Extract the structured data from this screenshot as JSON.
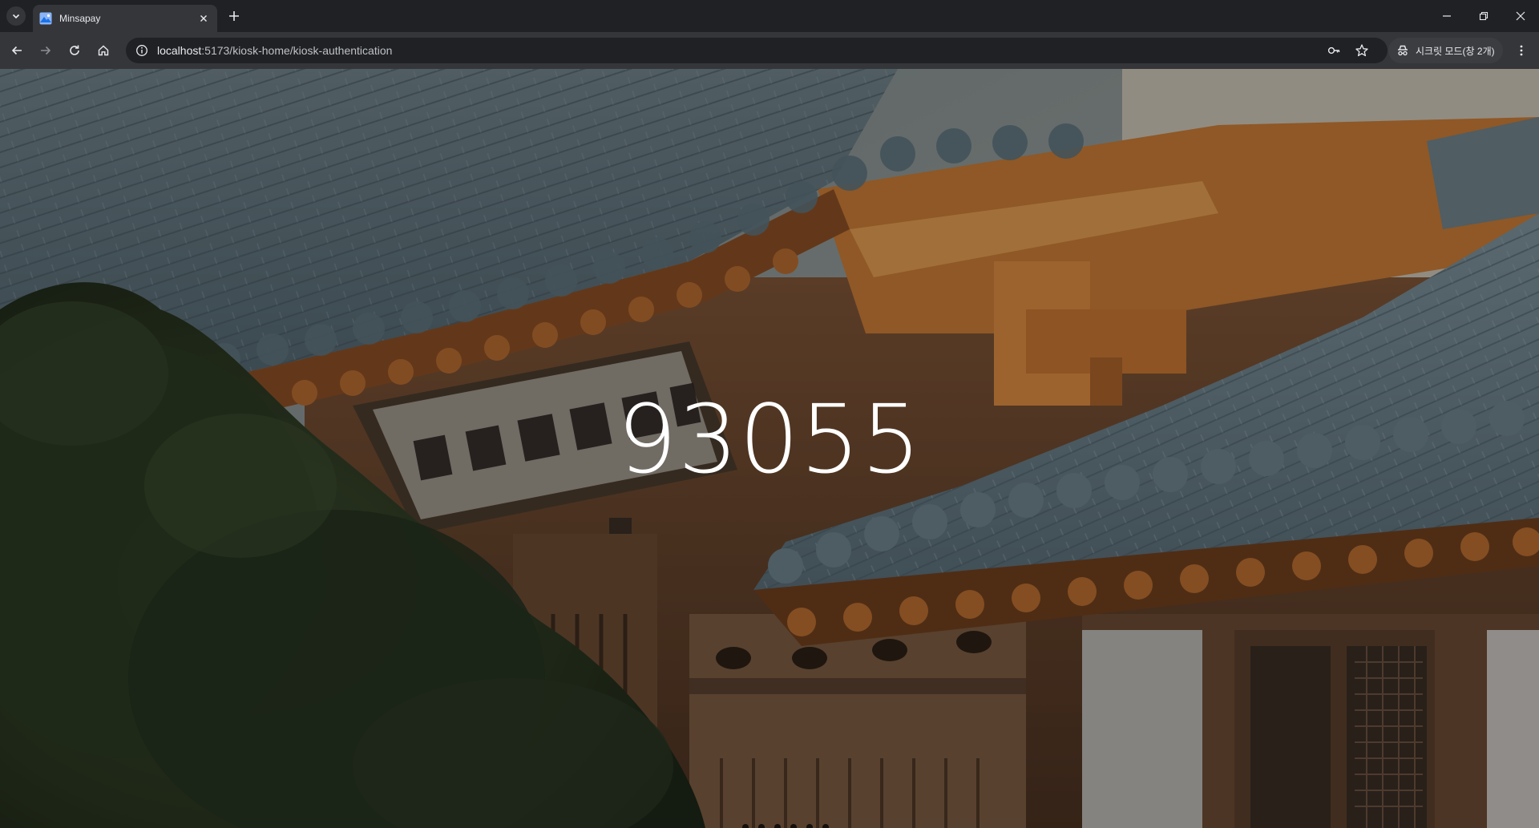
{
  "browser": {
    "tab_title": "Minsapay",
    "url_host": "localhost",
    "url_path": ":5173/kiosk-home/kiosk-authentication",
    "incognito_label": "시크릿 모드(창 2개)",
    "icons": {
      "tab_search": "chevron-down-icon",
      "tab_close": "close-icon",
      "new_tab": "plus-icon",
      "minimize": "minimize-icon",
      "restore": "restore-icon",
      "close_window": "close-icon",
      "back": "arrow-left-icon",
      "forward": "arrow-right-icon",
      "reload": "reload-icon",
      "home": "home-icon",
      "site_info": "info-icon",
      "password_key": "key-icon",
      "bookmark": "star-icon",
      "incognito": "incognito-icon",
      "menu": "more-vertical-icon"
    }
  },
  "kiosk": {
    "auth_code": "93055"
  },
  "colors": {
    "chrome_dark": "#202124",
    "chrome_toolbar": "#35363a",
    "code_text": "#ffffff"
  }
}
